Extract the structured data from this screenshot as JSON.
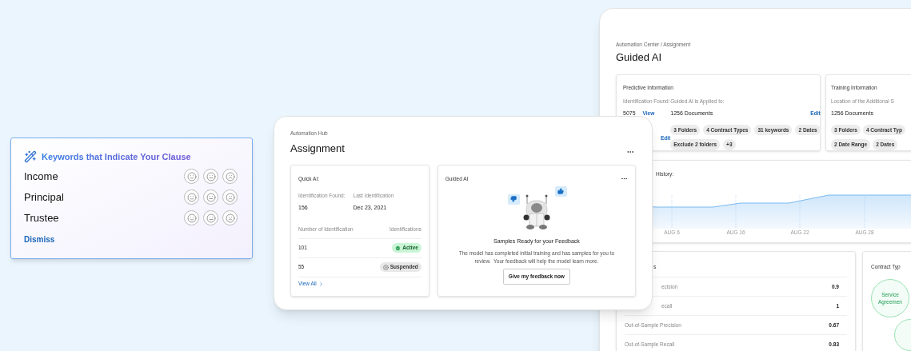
{
  "keyword_card": {
    "title": "Keywords that Indicate Your Clause",
    "keywords": [
      {
        "label": "Income"
      },
      {
        "label": "Principal"
      },
      {
        "label": "Trustee"
      }
    ],
    "dismiss": "Dismiss"
  },
  "assignment_panel": {
    "breadcrumb": "Automation Hub",
    "title": "Assignment",
    "quick_ai": {
      "title": "Quick AI:",
      "stats": [
        {
          "label": "Identification Found:",
          "value": "156"
        },
        {
          "label": "Last Identification",
          "value": "Dec 23, 2021"
        }
      ],
      "columns": [
        "Number of Identification",
        "Identifications"
      ],
      "rows": [
        {
          "number": "101",
          "status": "Active",
          "kind": "active"
        },
        {
          "number": "55",
          "status": "Suspended",
          "kind": "suspended"
        }
      ],
      "link": "View All"
    },
    "guided_ai": {
      "title": "Guided AI",
      "heading": "Samples Ready for your Feedback",
      "body": "The model has completed initial training and has samples for you to review.  Your feedback will help the model learn more.",
      "button": "Give my feedback now"
    }
  },
  "guided_panel": {
    "breadcrumb": "Automation Center / Assignment",
    "title": "Guided AI",
    "predictive": {
      "title": "Predictive Information",
      "found_label": "Identification Found:",
      "found_value": "5075",
      "view": "View",
      "edit_left": "Edit",
      "applied_label": "Guided AI is Applied to:",
      "applied_value": "1256 Documents",
      "edit": "Edit",
      "chip_rows": [
        [
          "3 Folders",
          "4 Contract Types",
          "31 keywords",
          "2 Dates"
        ],
        [
          "Exclude 2 folders",
          "+3"
        ]
      ]
    },
    "training": {
      "title": "Training Information",
      "location_label": "Location of the Additional S",
      "value": "1256 Documents",
      "chip_rows": [
        [
          "3 Folders",
          "4 Contract Typ"
        ],
        [
          "2 Date Range",
          "2 Dates"
        ]
      ]
    },
    "history": {
      "title": "History:",
      "ticks": [
        "AUG 6",
        "AUG 16",
        "AUG 22",
        "AUG 28"
      ]
    },
    "metrics": {
      "title": "s",
      "rows": [
        {
          "label": "ecision",
          "value": "0.9",
          "kind": "partial"
        },
        {
          "label": "ecall",
          "value": "1",
          "kind": "partial"
        },
        {
          "label": "Out-of-Sample Precision",
          "value": "0.67",
          "kind": "full"
        },
        {
          "label": "Out-of-Sample Recall",
          "value": "0.83",
          "kind": "full"
        }
      ]
    },
    "contract_types": {
      "title": "Contract Typ",
      "bubbles": [
        "Service Agreemen"
      ]
    }
  }
}
